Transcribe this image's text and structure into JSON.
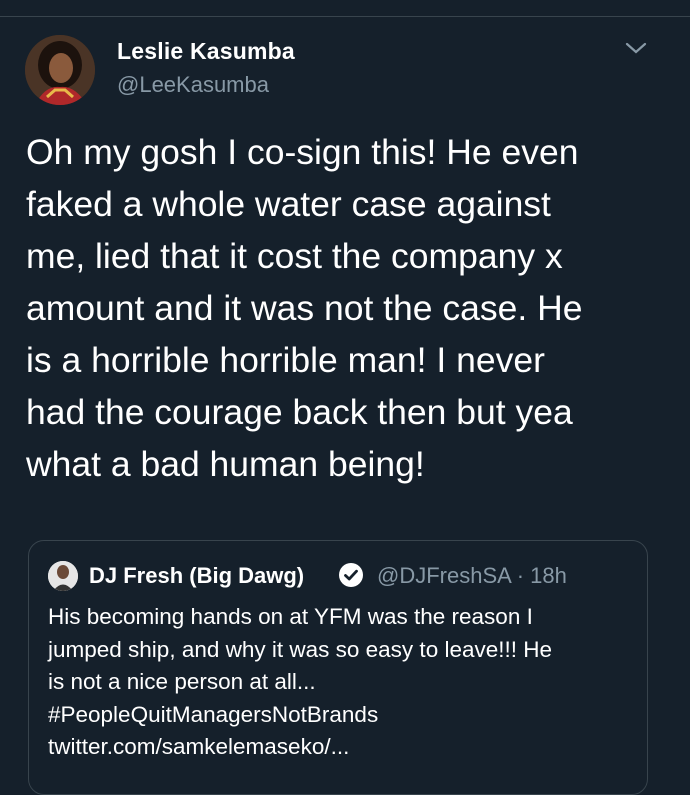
{
  "tweet": {
    "author_name": "Leslie Kasumba",
    "author_handle": "@LeeKasumba",
    "text": "Oh my gosh I co-sign this! He even\nfaked a whole water case against\nme, lied that it cost the company x\namount and it was not the case. He\nis a horrible horrible man! I never\nhad the courage back then but yea\nwhat a bad human being!",
    "menu_icon": "chevron-down-icon"
  },
  "quoted_tweet": {
    "author_name": "DJ Fresh (Big Dawg)",
    "author_handle": "@DJFreshSA · 18h",
    "verified_icon": "verified-badge-icon",
    "text": "His becoming hands on at YFM was the reason I\njumped ship, and why it was so easy to leave!!! He\nis not a nice person at all...\n#PeopleQuitManagersNotBrands",
    "link": "twitter.com/samkelemaseko/..."
  },
  "colors": {
    "background": "#15202b",
    "text_primary": "#ffffff",
    "text_secondary": "#8899a6",
    "border": "#38444d"
  }
}
